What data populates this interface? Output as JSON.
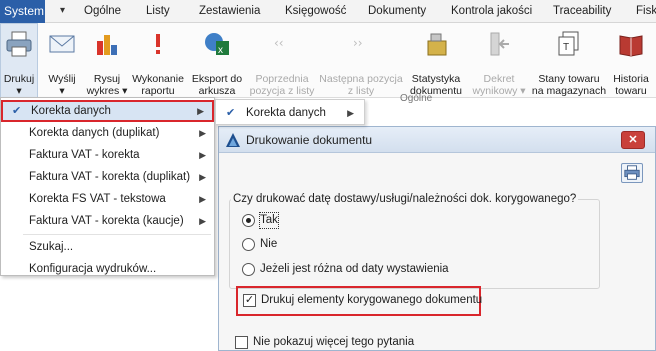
{
  "menubar": {
    "system": "System",
    "qa_icon": "dropdown-arrow-icon",
    "tabs": [
      "Ogólne",
      "Listy",
      "Zestawienia",
      "Księgowość",
      "Dokumenty",
      "Kontrola jakości",
      "Traceability",
      "Fisk"
    ]
  },
  "ribbon": {
    "buttons": [
      {
        "label": "Drukuj\n▾",
        "icon": "printer-icon",
        "disabled": false
      },
      {
        "label": "Wyślij\n▾",
        "icon": "envelope-icon",
        "disabled": false
      },
      {
        "label": "Rysuj\nwykres ▾",
        "icon": "bar-chart-icon",
        "disabled": false
      },
      {
        "label": "Wykonanie\nraportu",
        "icon": "exclamation-icon",
        "disabled": false
      },
      {
        "label": "Eksport do\narkusza",
        "icon": "excel-export-icon",
        "disabled": false
      },
      {
        "label": "Poprzednia\npozycja z listy",
        "icon": "prev-arrow-icon",
        "disabled": true
      },
      {
        "label": "Następna pozycja\nz listy",
        "icon": "next-arrow-icon",
        "disabled": true
      },
      {
        "label": "Statystyka\ndokumentu",
        "icon": "weights-icon",
        "disabled": false
      },
      {
        "label": "Dekret\nwynikowy ▾",
        "icon": "dekret-icon",
        "disabled": true
      },
      {
        "label": "Stany towaru\nna magazynach",
        "icon": "stock-icon",
        "disabled": false
      },
      {
        "label": "Historia\ntowaru",
        "icon": "history-book-icon",
        "disabled": false
      }
    ],
    "group_label": "Ogólne"
  },
  "dropdown": {
    "items": [
      {
        "label": "Korekta danych",
        "checked": true,
        "submenu": true
      },
      {
        "label": "Korekta danych (duplikat)",
        "checked": false,
        "submenu": true
      },
      {
        "label": "Faktura VAT - korekta",
        "checked": false,
        "submenu": true
      },
      {
        "label": "Faktura VAT - korekta (duplikat)",
        "checked": false,
        "submenu": true
      },
      {
        "label": "Korekta FS VAT - tekstowa",
        "checked": false,
        "submenu": true
      },
      {
        "label": "Faktura VAT - korekta (kaucje)",
        "checked": false,
        "submenu": true
      },
      {
        "label": "Szukaj...",
        "checked": false,
        "submenu": false
      },
      {
        "label": "Konfiguracja wydruków...",
        "checked": false,
        "submenu": false
      }
    ]
  },
  "submenu": {
    "label": "Korekta danych",
    "checked": true
  },
  "dialog": {
    "title": "Drukowanie dokumentu",
    "question": "Czy drukować datę dostawy/usługi/należności dok. korygowanego?",
    "options": [
      "Tak",
      "Nie",
      "Jeżeli jest różna od daty wystawienia"
    ],
    "selected_option": "Tak",
    "checkbox_label": "Drukuj elementy korygowanego dokumentu",
    "checkbox_checked": true,
    "dont_show_label": "Nie pokazuj więcej tego pytania",
    "dont_show_checked": false
  },
  "colors": {
    "accent": "#2b5fa8",
    "highlight_border": "#d9262c",
    "close_button": "#c9413b"
  }
}
